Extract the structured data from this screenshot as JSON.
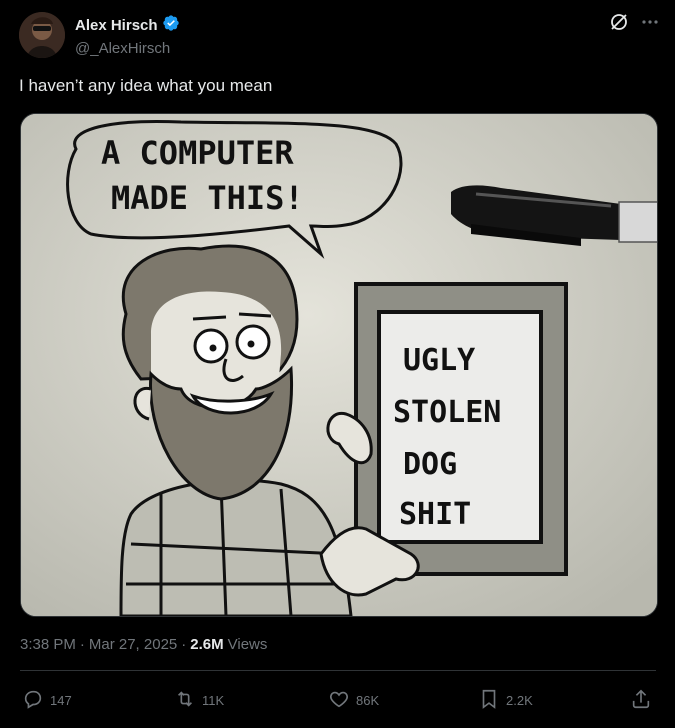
{
  "author": {
    "display_name": "Alex Hirsch",
    "handle": "@_AlexHirsch",
    "verified": true
  },
  "tweet": {
    "text": "I haven’t any idea what you mean"
  },
  "drawing": {
    "speech_line1": "A COMPUTER",
    "speech_line2": "MADE THIS!",
    "sign_line1": "UGLY",
    "sign_line2": "STOLEN",
    "sign_line3": "DOG",
    "sign_line4": "SHIT"
  },
  "meta": {
    "time": "3:38 PM",
    "separator": "·",
    "date": "Mar 27, 2025",
    "views_count": "2.6M",
    "views_label": "Views"
  },
  "actions": {
    "replies": "147",
    "reposts": "11K",
    "likes": "86K",
    "bookmarks": "2.2K"
  },
  "icons": {
    "verified": "verified-badge-icon",
    "grok": "grok-icon",
    "more": "more-icon",
    "reply": "reply-icon",
    "repost": "repost-icon",
    "like": "like-icon",
    "bookmark": "bookmark-icon",
    "share": "share-icon"
  },
  "colors": {
    "background": "#000000",
    "text": "#e7e9ea",
    "secondary_text": "#71767b",
    "verified_blue": "#1d9bf0",
    "border": "#2f3336"
  }
}
